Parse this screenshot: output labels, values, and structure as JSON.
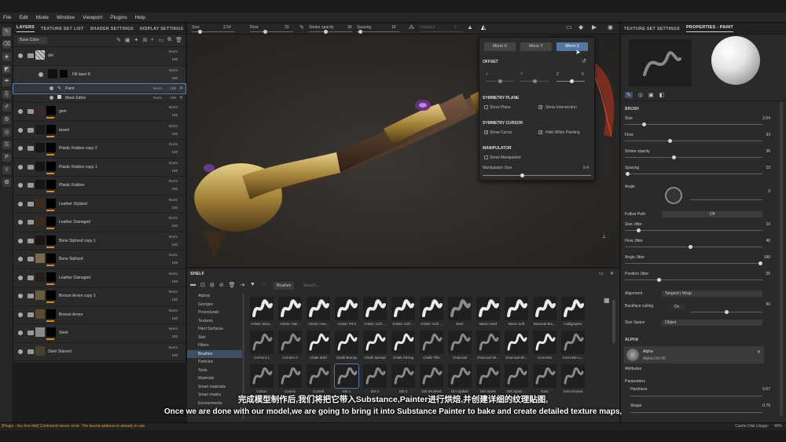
{
  "menu": [
    "File",
    "Edit",
    "Mode",
    "Window",
    "Viewport",
    "Plugins",
    "Help"
  ],
  "left_tabs": [
    "LAYERS",
    "TEXTURE SET LIST",
    "SHADER SETTINGS",
    "DISPLAY SETTINGS"
  ],
  "channel_select": "Base Color",
  "layers": [
    {
      "name": "dirt",
      "blend": "Norm",
      "opacity": "100"
    },
    {
      "name": "Fill layer 8",
      "blend": "Norm",
      "opacity": "100"
    },
    {
      "name": "gem",
      "blend": "Norm",
      "opacity": "100"
    },
    {
      "name": "tassel",
      "blend": "Norm",
      "opacity": "100"
    },
    {
      "name": "Plastic Rubber copy 2",
      "blend": "Norm",
      "opacity": "100"
    },
    {
      "name": "Plastic Rubber copy 1",
      "blend": "Norm",
      "opacity": "100"
    },
    {
      "name": "Plastic Rubber",
      "blend": "Norm",
      "opacity": "100"
    },
    {
      "name": "Leather Stylized",
      "blend": "Norm",
      "opacity": "100"
    },
    {
      "name": "Leather Damaged",
      "blend": "Norm",
      "opacity": "100"
    },
    {
      "name": "Bone Stylized copy 1",
      "blend": "Norm",
      "opacity": "100"
    },
    {
      "name": "Bone Stylized",
      "blend": "Norm",
      "opacity": "100"
    },
    {
      "name": "Leather Damaged",
      "blend": "Norm",
      "opacity": "100"
    },
    {
      "name": "Bronze Armor copy 1",
      "blend": "Norm",
      "opacity": "100"
    },
    {
      "name": "Bronze Armor",
      "blend": "Norm",
      "opacity": "100"
    },
    {
      "name": "Steel",
      "blend": "Norm",
      "opacity": "100"
    },
    {
      "name": "Steel Stained",
      "blend": "Norm",
      "opacity": "100"
    }
  ],
  "sublayers": {
    "paint": {
      "name": "Paint",
      "blend": "Norm",
      "opacity": "100"
    },
    "mask": {
      "name": "Mask Editor",
      "blend": "Norm",
      "opacity": "100"
    }
  },
  "topbar": {
    "size_label": "Size",
    "size_value": "2.54",
    "flow_label": "Flow",
    "flow_value": "33",
    "stroke_label": "Stroke opacity",
    "stroke_value": "36",
    "spacing_label": "Spacing",
    "spacing_value": "10",
    "distance_label": "Distance",
    "distance_value": "5"
  },
  "mirror_popup": {
    "buttons": [
      "Mirror X",
      "Mirror Y",
      "Mirror Z"
    ],
    "offset_title": "OFFSET",
    "axes": [
      "X",
      "Y",
      "Z"
    ],
    "z_value": "0",
    "sym_plane_title": "SYMMETRY PLANE",
    "show_plane": "Show Plane",
    "show_intersection": "Show Intersection",
    "sym_cursor_title": "SYMMETRY CURSOR",
    "show_cursor": "Show Cursor",
    "hide_while_painting": "Hide While Painting",
    "manipulator_title": "MANIPULATOR",
    "show_manipulator": "Show Manipulator",
    "manipulator_size_label": "Manipulator Size",
    "manipulator_size_value": "0.4"
  },
  "shelf": {
    "title": "SHELF",
    "filter_tag": "Brushes",
    "search_placeholder": "Search...",
    "categories": [
      "Alphas",
      "Grunges",
      "Procedurals",
      "Textures",
      "Hard Surfaces",
      "Skin",
      "Filters",
      "Brushes",
      "Particles",
      "Tools",
      "Materials",
      "Smart materials",
      "Smart masks",
      "Environments"
    ],
    "selected_category": "Brushes",
    "brushes_row1": [
      "Artistic Brus...",
      "Artistic Hair...",
      "Artistic Hea...",
      "Artistic Print",
      "Artistic Soft ...",
      "Artistic Soft ...",
      "Artistic Soft ...",
      "Bark",
      "Basic Hard",
      "Basic Soft",
      "Basmati Bru...",
      "Calligraphic"
    ],
    "brushes_row2": [
      "Cement 1",
      "Cement 2",
      "Chalk Bold",
      "Chalk Bumpy",
      "Chalk Spread",
      "Chalk Strong",
      "Chalk Thin",
      "Charcoal",
      "Charcoal Str...",
      "Charcoal Wi...",
      "Concrete",
      "Concrete Li..."
    ],
    "brushes_row3": [
      "Cotton",
      "Cracks",
      "Crystal",
      "Dirt 1",
      "Dirt 2",
      "Dirt 3",
      "Dirt Brushed",
      "Dirt Splash",
      "Dirt Spots",
      "Dirt Spots ...",
      "Dots",
      "Dots Erased"
    ]
  },
  "right_tabs": [
    "TEXTURE SET SETTINGS",
    "PROPERTIES - PAINT"
  ],
  "brush": {
    "title": "BRUSH",
    "params": [
      {
        "label": "Size",
        "value": "2.54",
        "fill": 0.14
      },
      {
        "label": "Flow",
        "value": "33",
        "fill": 0.33
      },
      {
        "label": "Stroke opacity",
        "value": "36",
        "fill": 0.36
      },
      {
        "label": "Spacing",
        "value": "10",
        "fill": 0.02
      }
    ],
    "angle_label": "Angle",
    "angle_value": "0",
    "follow_path_label": "Follow Path",
    "follow_path_value": "Off",
    "jitters": [
      {
        "label": "Size Jitter",
        "value": "10",
        "fill": 0.1
      },
      {
        "label": "Flow Jitter",
        "value": "48",
        "fill": 0.48
      },
      {
        "label": "Angle Jitter",
        "value": "180",
        "fill": 1.0
      },
      {
        "label": "Position Jitter",
        "value": "25",
        "fill": 0.25
      }
    ],
    "alignment_label": "Alignment",
    "alignment_value": "Tangent | Wrap",
    "backface_label": "Backface culling",
    "backface_toggle": "On",
    "backface_value": "90",
    "backface_fill": 0.5,
    "size_space_label": "Size Space",
    "size_space_value": "Object"
  },
  "alpha": {
    "title": "ALPHA",
    "name": "Alpha",
    "file": "Alpha Dirt 06",
    "attributes": "Attributes",
    "parameters": "Parameters",
    "hardness_label": "Hardness",
    "hardness_value": "0.67",
    "shape_label": "Shape",
    "shape_value": "0.75"
  },
  "status": {
    "error": "[Plugin - dcc-live-link] Command server error: The bound address is already in use",
    "cache": "Cache Disk Usage:",
    "cache_value": "49%"
  },
  "subtitles": {
    "zh": "完成模型制作后,我们将把它带入Substance,Painter进行烘焙,并创建详细的纹理贴图,",
    "en": "Once we are done with our model,we are going to bring it into Substance Painter to bake and create detailed texture maps,"
  },
  "colors": {
    "accent": "#5477a4",
    "layer_bar": "#d68a1f",
    "error_text": "#d9a12a"
  }
}
